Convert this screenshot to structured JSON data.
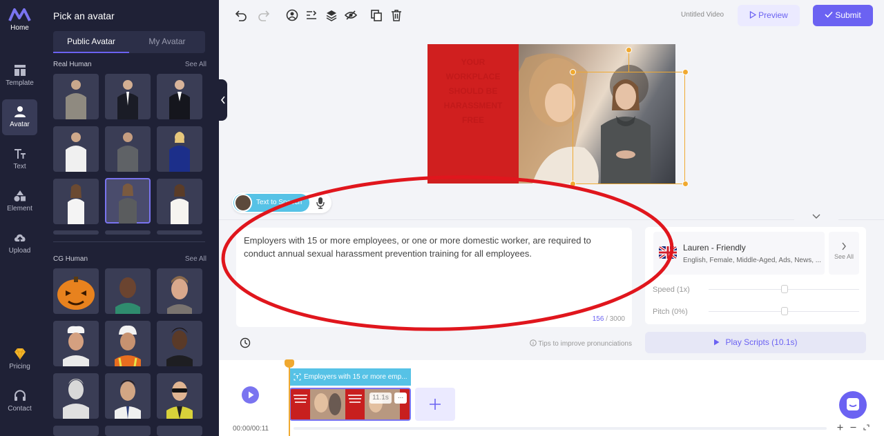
{
  "nav": {
    "items": [
      {
        "label": "Home",
        "icon": "logo-icon"
      },
      {
        "label": "Template",
        "icon": "template-icon"
      },
      {
        "label": "Avatar",
        "icon": "avatar-icon"
      },
      {
        "label": "Text",
        "icon": "text-icon"
      },
      {
        "label": "Element",
        "icon": "element-icon"
      },
      {
        "label": "Upload",
        "icon": "upload-icon"
      },
      {
        "label": "Pricing",
        "icon": "diamond-icon"
      },
      {
        "label": "Contact",
        "icon": "contact-icon"
      }
    ]
  },
  "panel": {
    "title": "Pick an avatar",
    "tabs": [
      "Public Avatar",
      "My Avatar"
    ],
    "sections": [
      {
        "label": "Real Human",
        "see_all": "See All"
      },
      {
        "label": "CG Human",
        "see_all": "See All"
      }
    ]
  },
  "toolbar": {
    "video_title": "Untitled Video",
    "preview_label": "Preview",
    "submit_label": "Submit"
  },
  "canvas": {
    "poster_text": "YOUR WORKPLACE SHOULD BE HARASSMENT FREE"
  },
  "tts": {
    "label": "Text to Speech"
  },
  "script": {
    "text": "Employers with 15 or more employees, or one or more domestic worker, are required to conduct annual sexual harassment prevention training for all employees.",
    "count": "156",
    "max": "/ 3000",
    "tips": "Tips to improve pronunciations"
  },
  "voice": {
    "name": "Lauren - Friendly",
    "meta": "English, Female, Middle-Aged, Ads, News, ...",
    "see_all": "See All",
    "speed_label": "Speed (1x)",
    "pitch_label": "Pitch (0%)",
    "play_label": "Play Scripts (10.1s)"
  },
  "timeline": {
    "text_clip": "Employers with 15 or more emp...",
    "clip_duration": "11.1s",
    "clip_menu": "...",
    "time_code": "00:00/00:11"
  },
  "colors": {
    "accent": "#6b62f2",
    "nav_bg": "#1f2136",
    "tts_blue": "#56c2e6",
    "selection": "#f0a930"
  }
}
